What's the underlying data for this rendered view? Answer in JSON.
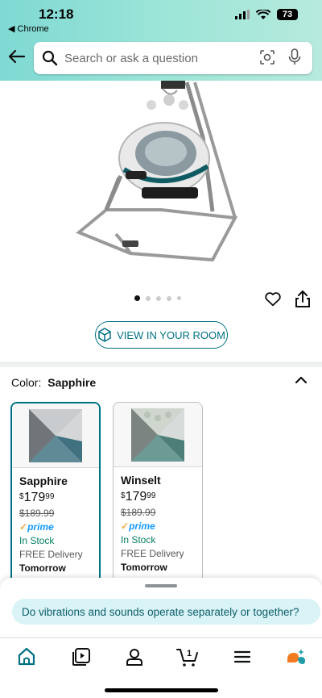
{
  "status_bar": {
    "time": "12:18",
    "back_app": "◀ Chrome",
    "battery": "73"
  },
  "search": {
    "placeholder": "Search or ask a question",
    "value": ""
  },
  "icons": {
    "back": "back-arrow-icon",
    "search": "search-icon",
    "camera": "camera-icon",
    "mic": "mic-icon",
    "heart": "heart-icon",
    "share": "share-icon",
    "ar": "ar-cube-icon",
    "collapse": "chevron-up-icon"
  },
  "gallery": {
    "image_count": 5,
    "active_index": 0
  },
  "view_in_room": {
    "label": "VIEW IN YOUR ROOM"
  },
  "color": {
    "label": "Color:",
    "selected": "Sapphire"
  },
  "swatches": [
    {
      "name": "Sapphire",
      "price_whole": "179",
      "price_cents": "99",
      "currency": "$",
      "list_price": "$189.99",
      "prime": "prime",
      "stock": "In Stock",
      "delivery": "FREE Delivery",
      "delivery_day": "Tomorrow",
      "selected": true
    },
    {
      "name": "Winselt",
      "price_whole": "179",
      "price_cents": "99",
      "currency": "$",
      "list_price": "$189.99",
      "prime": "prime",
      "stock": "In Stock",
      "delivery": "FREE Delivery",
      "delivery_day": "Tomorrow",
      "selected": false
    }
  ],
  "assistant": {
    "suggested_question": "Do vibrations and sounds operate separately or together?"
  },
  "bottom_nav": {
    "items": [
      "home-icon",
      "video-icon",
      "account-icon",
      "cart-icon",
      "menu-icon",
      "rufus-icon"
    ],
    "cart_count": "1",
    "accent_color": "#007185"
  },
  "colors": {
    "header_teal": "#8fe0d6",
    "link_teal": "#007185",
    "prime_blue": "#1399ff",
    "in_stock_green": "#067d62"
  }
}
